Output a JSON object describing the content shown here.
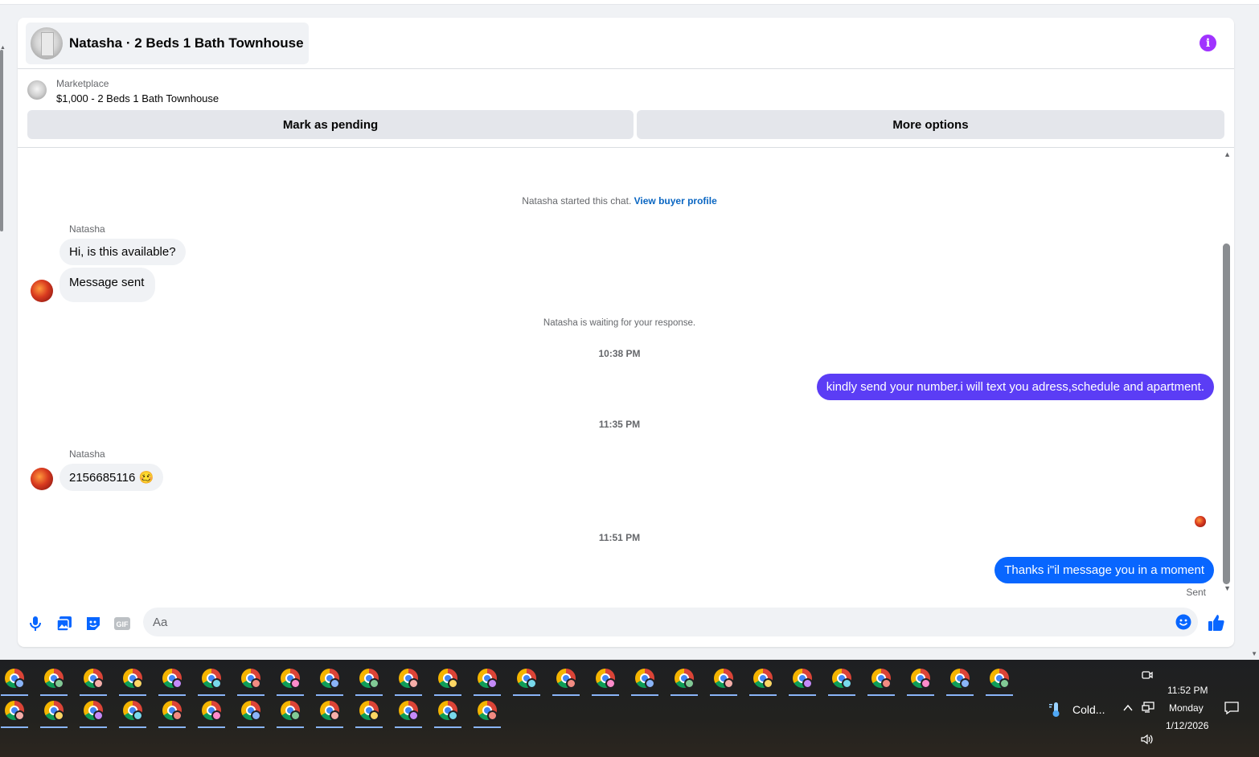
{
  "conversation": {
    "title": "Natasha · 2 Beds 1 Bath Townhouse",
    "listing_source": "Marketplace",
    "listing_name": "$1,000 - 2 Beds 1 Bath Townhouse",
    "mark_pending_label": "Mark as pending",
    "more_options_label": "More options"
  },
  "thread": {
    "started_text": "Natasha started this chat.",
    "view_profile_label": "View buyer profile",
    "waiting_text": "Natasha is waiting for your response.",
    "messages": [
      {
        "sender": "Natasha",
        "text": "Hi, is this available?"
      },
      {
        "sender": "Natasha",
        "text": "Message sent"
      },
      {
        "time": "10:38 PM"
      },
      {
        "sender": "me",
        "text": "kindly send your number.i will text you adress,schedule and apartment."
      },
      {
        "time": "11:35 PM"
      },
      {
        "sender": "Natasha",
        "text": "2156685116 🥴"
      },
      {
        "time": "11:51 PM"
      },
      {
        "sender": "me",
        "text": "Thanks i\"il message you in a moment"
      }
    ],
    "sender_name": "Natasha",
    "sent_status": "Sent"
  },
  "composer": {
    "placeholder": "Aa"
  },
  "taskbar": {
    "weather": "Cold...",
    "time": "11:52 PM",
    "day": "Monday",
    "date": "1/12/2026"
  },
  "colors": {
    "outgoing_1": "#5b3df5",
    "outgoing_2": "#0866ff",
    "accent": "#0866ff",
    "info": "#a033ff"
  }
}
